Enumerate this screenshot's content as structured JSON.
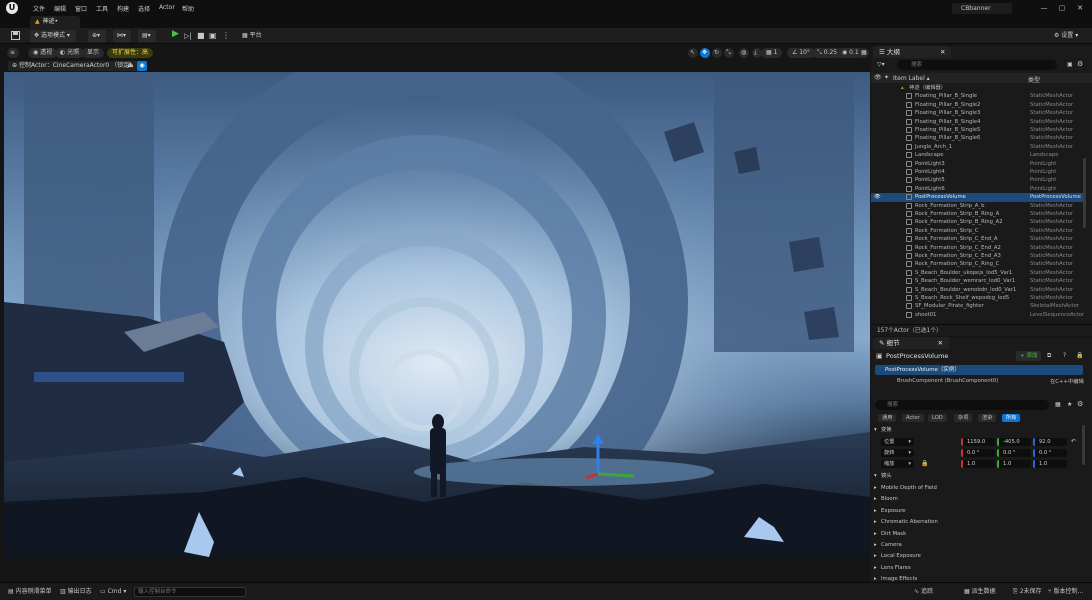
{
  "menubar": {
    "logo": "U",
    "items": [
      "文件",
      "编辑",
      "窗口",
      "工具",
      "构建",
      "选择",
      "Actor",
      "帮助"
    ],
    "user": "CBbanner",
    "window_buttons": [
      "—",
      "▢",
      "✕"
    ]
  },
  "doc_tab": {
    "icon": "▲",
    "label": "神迹•"
  },
  "toolbar": {
    "save_icon": "save-icon",
    "mode": "选项模式",
    "platform": "平台",
    "settings": "设置"
  },
  "viewport": {
    "buttons": [
      "透视",
      "光照",
      "显示"
    ],
    "scalability": "可扩展性：高",
    "pilot_label": "控制Actor：CineCameraActor0 （锁定）",
    "right_values": [
      "1",
      "10°",
      "0.25",
      "0.1"
    ],
    "colors": {
      "sky_top": "#3d5a80",
      "sky_mid": "#8fb2d4",
      "ground": "#1a2436",
      "crystal": "#a8c8f0"
    }
  },
  "bottombar": {
    "content_drawer": "内容侧滑菜单",
    "output_log": "输出日志",
    "cmd": "Cmd",
    "cmd_placeholder": "输入控制台命令",
    "trace": "追踪",
    "derived_data": "派生数据",
    "unsaved": "2未保存",
    "source_control": "版本控制..."
  },
  "outliner": {
    "tab": "大纲",
    "search_placeholder": "搜索",
    "col_label": "Item Label ▴",
    "col_type": "类型",
    "root": "神迹（编辑器）",
    "rows": [
      {
        "name": "Floating_Pillar_B_Single",
        "type": "StaticMeshActor"
      },
      {
        "name": "Floating_Pillar_B_Single2",
        "type": "StaticMeshActor"
      },
      {
        "name": "Floating_Pillar_B_Single3",
        "type": "StaticMeshActor"
      },
      {
        "name": "Floating_Pillar_B_Single4",
        "type": "StaticMeshActor"
      },
      {
        "name": "Floating_Pillar_B_Single5",
        "type": "StaticMeshActor"
      },
      {
        "name": "Floating_Pillar_B_Single6",
        "type": "StaticMeshActor"
      },
      {
        "name": "Jungle_Arch_1",
        "type": "StaticMeshActor"
      },
      {
        "name": "Landscape",
        "type": "Landscape"
      },
      {
        "name": "PointLight3",
        "type": "PointLight"
      },
      {
        "name": "PointLight4",
        "type": "PointLight"
      },
      {
        "name": "PointLight5",
        "type": "PointLight"
      },
      {
        "name": "PointLight6",
        "type": "PointLight"
      },
      {
        "name": "PostProcessVolume",
        "type": "PostProcessVolume",
        "selected": true
      },
      {
        "name": "Rock_Formation_Strip_A_b",
        "type": "StaticMeshActor"
      },
      {
        "name": "Rock_Formation_Strip_B_Ring_A",
        "type": "StaticMeshActor"
      },
      {
        "name": "Rock_Formation_Strip_B_Ring_A2",
        "type": "StaticMeshActor"
      },
      {
        "name": "Rock_Formation_Strip_C",
        "type": "StaticMeshActor"
      },
      {
        "name": "Rock_Formation_Strip_C_End_A",
        "type": "StaticMeshActor"
      },
      {
        "name": "Rock_Formation_Strip_C_End_A2",
        "type": "StaticMeshActor"
      },
      {
        "name": "Rock_Formation_Strip_C_End_A3",
        "type": "StaticMeshActor"
      },
      {
        "name": "Rock_Formation_Strip_C_Ring_C",
        "type": "StaticMeshActor"
      },
      {
        "name": "S_Beach_Boulder_ukopejs_lod5_Var1",
        "type": "StaticMeshActor"
      },
      {
        "name": "S_Beach_Boulder_wemrarc_lod0_Var1",
        "type": "StaticMeshActor"
      },
      {
        "name": "S_Beach_Boulder_wenobdn_lod0_Var1",
        "type": "StaticMeshActor"
      },
      {
        "name": "S_Beach_Rock_Shelf_wepodcg_lod5",
        "type": "StaticMeshActor"
      },
      {
        "name": "SF_Modular_Pirate_fighter",
        "type": "SkeletalMeshActor"
      },
      {
        "name": "shoot01",
        "type": "LevelSequenceActor"
      }
    ],
    "status": "157个Actor（已选1个）"
  },
  "details": {
    "tab": "细节",
    "title": "PostProcessVolume",
    "add_button": "+ 添加",
    "instance": "PostProcessVolume（实例）",
    "component": "BrushComponent (BrushComponent0)",
    "edit_cpp": "在C++中编辑",
    "search_placeholder": "搜索",
    "filters": [
      "通用",
      "Actor",
      "LOD",
      "杂项",
      "渲染",
      "所有"
    ],
    "transform_header": "变换",
    "location_label": "位置",
    "rotation_label": "旋转",
    "scale_label": "缩放",
    "location": [
      "1159.0",
      "-405.0",
      "92.0"
    ],
    "rotation": [
      "0.0 °",
      "0.0 °",
      "0.0 °"
    ],
    "scale": [
      "1.0",
      "1.0",
      "1.0"
    ],
    "lens_header": "镜头",
    "sections": [
      "Mobile Depth of Field",
      "Bloom",
      "Exposure",
      "Chromatic Aberration",
      "Dirt Mask",
      "Camera",
      "Local Exposure",
      "Lens Flares",
      "Image Effects"
    ]
  }
}
